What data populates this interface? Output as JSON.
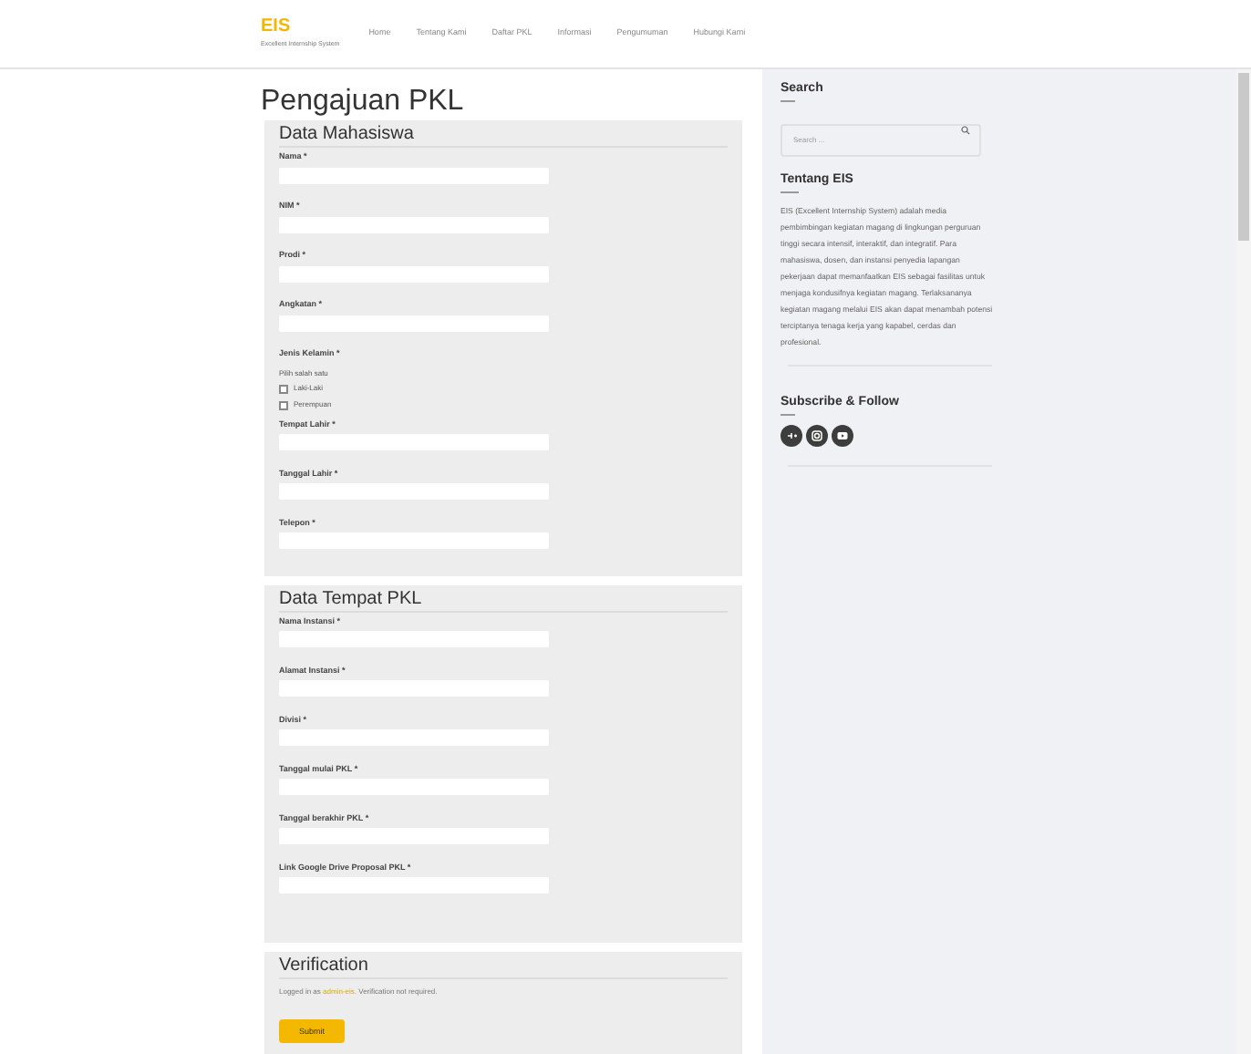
{
  "header": {
    "logo": "EIS",
    "tagline": "Excellent Internship System",
    "nav": [
      {
        "label": "Home",
        "selected": false
      },
      {
        "label": "Tentang Kami",
        "selected": false
      },
      {
        "label": "Daftar PKL",
        "selected": false
      },
      {
        "label": "Informasi",
        "selected": false
      },
      {
        "label": "Pengumuman",
        "selected": false
      },
      {
        "label": "Hubungi Kami",
        "selected": false
      }
    ]
  },
  "page_title": "Pengajuan PKL",
  "sections": [
    {
      "title": "Data Mahasiswa",
      "fields": [
        {
          "kind": "text",
          "label": "Nama *"
        },
        {
          "kind": "text",
          "label": "NIM *"
        },
        {
          "kind": "text",
          "label": "Prodi *"
        },
        {
          "kind": "text",
          "label": "Angkatan *"
        },
        {
          "kind": "radio",
          "label": "Jenis Kelamin *",
          "hint": "Pilih salah satu",
          "options": [
            {
              "label": "Laki-Laki",
              "checked": false
            },
            {
              "label": "Perempuan",
              "checked": false
            }
          ]
        },
        {
          "kind": "text",
          "label": "Tempat Lahir *"
        },
        {
          "kind": "text",
          "label": "Tanggal Lahir *"
        },
        {
          "kind": "text",
          "label": "Telepon *"
        }
      ]
    },
    {
      "title": "Data Tempat PKL",
      "fields": [
        {
          "kind": "text",
          "label": "Nama Instansi *"
        },
        {
          "kind": "text",
          "label": "Alamat Instansi *"
        },
        {
          "kind": "text",
          "label": "Divisi *"
        },
        {
          "kind": "text",
          "label": "Tanggal mulai PKL *"
        },
        {
          "kind": "text",
          "label": "Tanggal berakhir PKL *"
        },
        {
          "kind": "text",
          "label": "Link Google Drive Proposal PKL *"
        }
      ]
    }
  ],
  "verification": {
    "title": "Verification",
    "note_prefix": "Logged in as",
    "link": "admin-eis.",
    "note_suffix": "Verification not required.",
    "submit": "Submit"
  },
  "sidebar": {
    "search": {
      "title": "Search",
      "placeholder": "Search ..."
    },
    "about": {
      "title": "Tentang EIS",
      "text": "EIS (Excellent Internship System) adalah media pembimbingan kegiatan magang di lingkungan perguruan tinggi secara intensif, interaktif, dan integratif. Para mahasiswa, dosen, dan instansi penyedia lapangan pekerjaan dapat memanfaatkan EIS sebagai fasilitas untuk menjaga kondusifnya kegiatan magang. Terlaksananya kegiatan magang melalui EIS akan dapat menambah potensi terciptanya tenaga kerja yang kapabel, cerdas dan profesional."
    },
    "follow": {
      "title": "Subscribe & Follow",
      "icons": [
        {
          "kind": "google"
        },
        {
          "kind": "instagram"
        },
        {
          "kind": "youtube"
        }
      ]
    }
  }
}
